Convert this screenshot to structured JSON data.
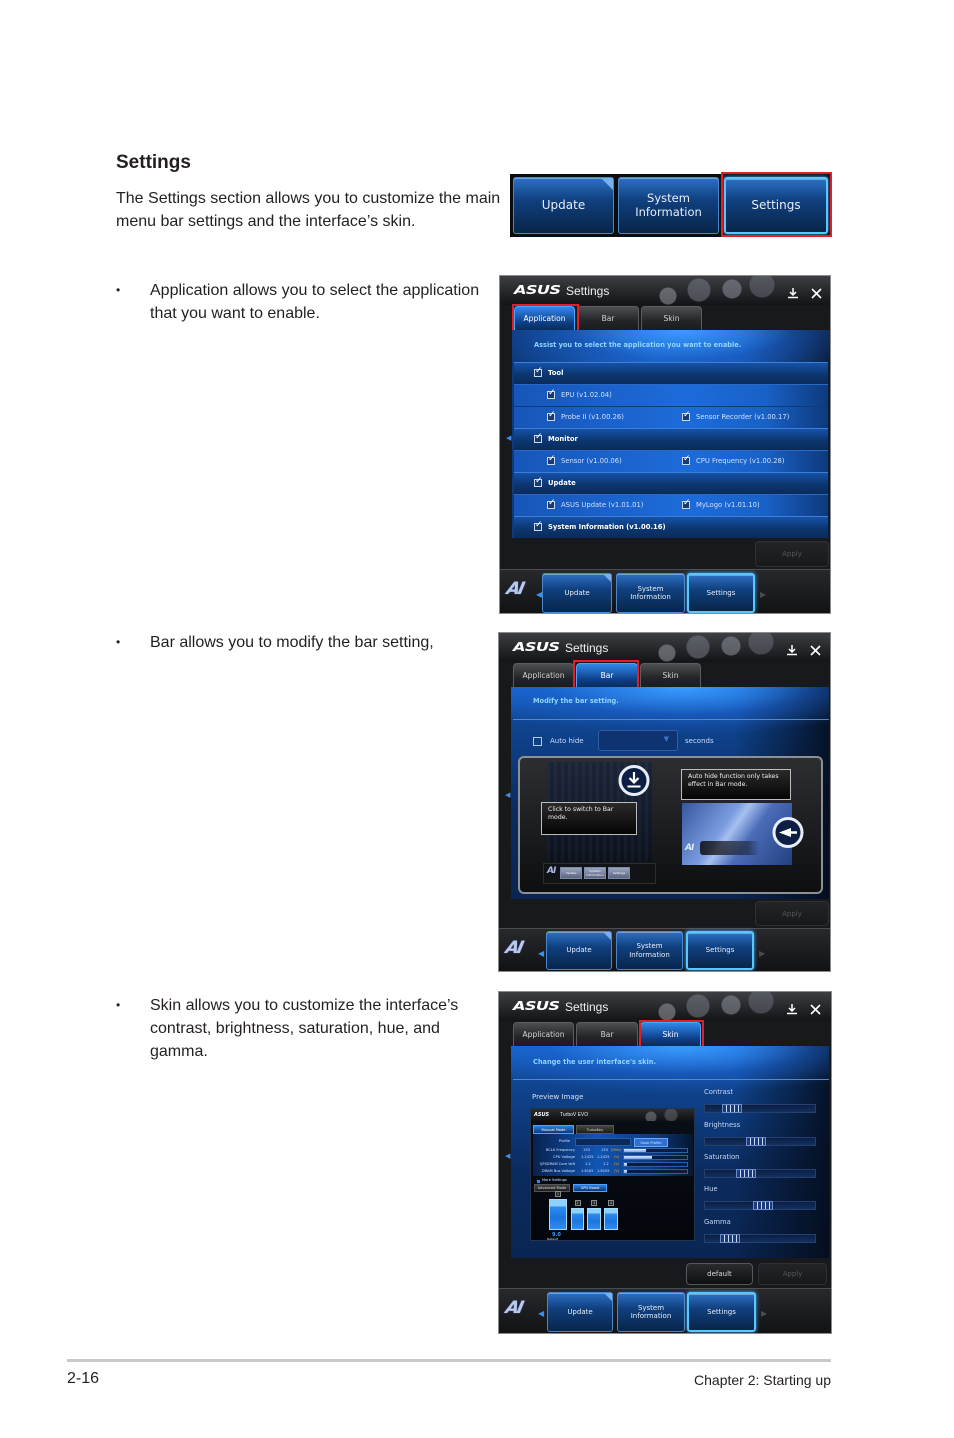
{
  "page": {
    "section_title": "Settings",
    "intro": "The Settings section allows you to customize the main menu bar settings and the interface’s skin.",
    "bullet_symbol": "•",
    "bullets": [
      "Application allows you to select the application that you want to enable.",
      "Bar allows you to modify the bar setting,",
      "Skin allows you to customize the interface’s contrast, brightness, saturation, hue, and gamma."
    ],
    "footer": {
      "page_number": "2-16",
      "chapter": "Chapter 2: Starting up"
    }
  },
  "menu_bar": {
    "buttons": [
      {
        "label": "Update",
        "has_new_badge": true
      },
      {
        "label_line1": "System",
        "label_line2": "Information"
      },
      {
        "label": "Settings",
        "highlighted": true
      }
    ]
  },
  "window": {
    "brand": "ASUS",
    "title": "Settings",
    "tabs": [
      "Application",
      "Bar",
      "Skin"
    ],
    "apply_label": "Apply",
    "default_label": "default",
    "bottom_bar": {
      "logo": "AI",
      "buttons": [
        {
          "label": "Update",
          "has_new_badge": true
        },
        {
          "label_line1": "System",
          "label_line2": "Information"
        },
        {
          "label": "Settings",
          "active": true
        }
      ]
    }
  },
  "application_tab": {
    "active_tab": "Application",
    "description": "Assist you to select the application you want to enable.",
    "rows": [
      {
        "type": "group",
        "label": "Tool",
        "checked": true
      },
      {
        "type": "item",
        "cells": [
          {
            "label": "EPU (v1.02.04)",
            "checked": true
          }
        ]
      },
      {
        "type": "item",
        "cells": [
          {
            "label": "Probe II (v1.00.26)",
            "checked": true
          },
          {
            "label": "Sensor Recorder (v1.00.17)",
            "checked": true
          }
        ]
      },
      {
        "type": "group",
        "label": "Monitor",
        "checked": true
      },
      {
        "type": "item",
        "cells": [
          {
            "label": "Sensor (v1.00.06)",
            "checked": true
          },
          {
            "label": "CPU Frequency (v1.00.28)",
            "checked": true
          }
        ]
      },
      {
        "type": "group",
        "label": "Update",
        "checked": true
      },
      {
        "type": "item",
        "cells": [
          {
            "label": "ASUS Update (v1.01.01)",
            "checked": true
          },
          {
            "label": "MyLogo (v1.01.10)",
            "checked": true
          }
        ]
      },
      {
        "type": "group",
        "label": "System Information (v1.00.16)",
        "checked": true
      }
    ]
  },
  "bar_tab": {
    "active_tab": "Bar",
    "description": "Modify the bar setting.",
    "auto_hide": {
      "label": "Auto hide",
      "checked": false,
      "seconds_value": "",
      "unit": "seconds"
    },
    "illustration": {
      "switch_callout": "Click to switch to Bar mode.",
      "autohide_callout": "Auto hide function only takes effect in Bar mode.",
      "mini_bar_logo": "AI",
      "mini_bar_buttons": [
        "Update",
        "System Information",
        "Settings"
      ]
    }
  },
  "skin_tab": {
    "active_tab": "Skin",
    "description": "Change the user interface's skin.",
    "preview_label": "Preview Image",
    "sliders": [
      {
        "label": "Contrast",
        "value": 0.19
      },
      {
        "label": "Brightness",
        "value": 0.46
      },
      {
        "label": "Saturation",
        "value": 0.34
      },
      {
        "label": "Hue",
        "value": 0.53
      },
      {
        "label": "Gamma",
        "value": 0.17
      }
    ],
    "preview": {
      "brand": "ASUS",
      "title": "TurboV EVO",
      "tabs": [
        "Manual Mode",
        "TurboKey"
      ],
      "profile_label": "Profile",
      "save_profile": "Save Profile",
      "rows": [
        {
          "label": "BCLK Frequency",
          "current": "133",
          "target": "133",
          "unit": "(MHz)",
          "level": 0.35
        },
        {
          "label": "CPU Voltage",
          "current": "1.2425",
          "target": "1.2425",
          "unit": "(V)",
          "level": 0.45
        },
        {
          "label": "QPI/DRAM Core Volt",
          "current": "1.2",
          "target": "1.2",
          "unit": "(V)",
          "level": 0.05
        },
        {
          "label": "DRAM Bus Voltage",
          "current": "1.6105",
          "target": "1.6105",
          "unit": "(V)",
          "level": 0.05
        }
      ],
      "more_settings": "More Settings",
      "sub_tabs": [
        "Advanced Mode",
        "GPU Boost"
      ],
      "bars": [
        {
          "label": "1",
          "level": 1.0
        },
        {
          "label": "2",
          "level": 0.71
        },
        {
          "label": "3",
          "level": 0.71
        },
        {
          "label": "4",
          "level": 0.71
        }
      ],
      "bar_value": "9.0",
      "bar_caption": "Default"
    }
  }
}
